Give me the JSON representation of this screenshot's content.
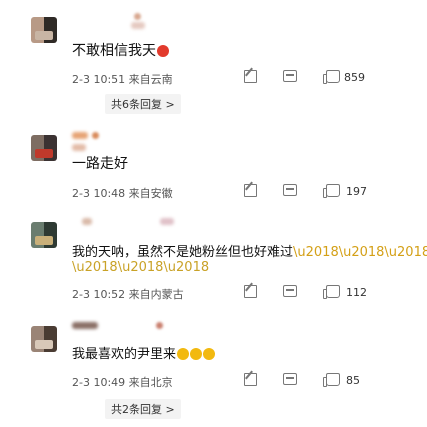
{
  "comments": [
    {
      "text": "不敢相信我天",
      "timestamp": "2-3 10:51 来自云南",
      "likes": "859",
      "replies": "共6条回复 >",
      "avatar_colors": [
        "#b89a86",
        "#2f2a26",
        "#c8b5a4"
      ]
    },
    {
      "text": "一路走好",
      "timestamp": "2-3 10:48 来自安徽",
      "likes": "197",
      "avatar_colors": [
        "#7e6d62",
        "#c0392b",
        "#3b3232"
      ]
    },
    {
      "text": "我的天呐，虽然不是她粉丝但也好难过",
      "text_line2": "",
      "timestamp": "2-3 10:52 来自内蒙古",
      "likes": "112",
      "avatar_colors": [
        "#6a7d6f",
        "#c9b07a",
        "#2e3a33"
      ]
    },
    {
      "text": "我最喜欢的尹里来",
      "timestamp": "2-3 10:49 来自北京",
      "likes": "85",
      "replies": "共2条回复 >",
      "avatar_colors": [
        "#9a8476",
        "#4a3c33",
        "#d8c8b8"
      ]
    }
  ]
}
